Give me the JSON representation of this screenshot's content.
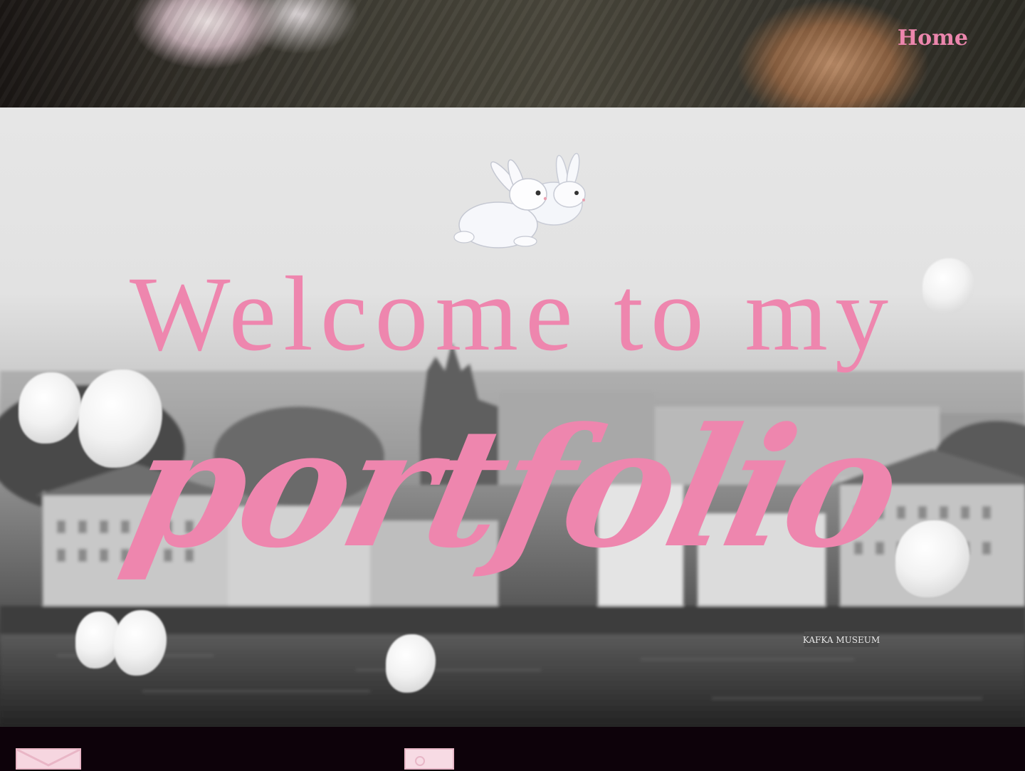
{
  "header": {
    "nav_home_label": "Home"
  },
  "hero": {
    "title_line1": "Welcome to my",
    "title_line2": "portfolio",
    "sign_text": "KAFKA MUSEUM"
  },
  "footer": {
    "icons": [
      "mail-icon",
      "photo-icon"
    ]
  },
  "colors": {
    "accent_pink": "#ee86ae",
    "footer_bg": "#0d020a"
  }
}
